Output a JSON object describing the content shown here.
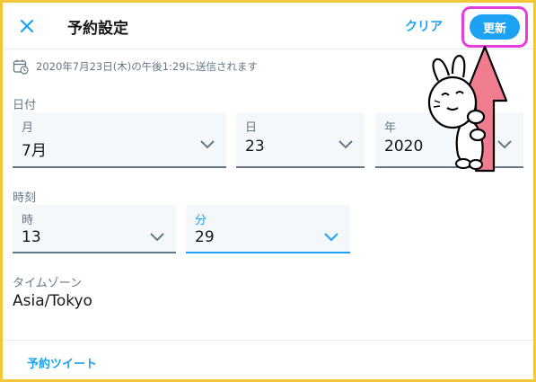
{
  "header": {
    "title": "予約設定",
    "clear_label": "クリア",
    "update_label": "更新"
  },
  "schedule_text": "2020年7月23日(木)の午後1:29に送信されます",
  "date_section": {
    "label": "日付",
    "month": {
      "label": "月",
      "value": "7月"
    },
    "day": {
      "label": "日",
      "value": "23"
    },
    "year": {
      "label": "年",
      "value": "2020"
    }
  },
  "time_section": {
    "label": "時刻",
    "hour": {
      "label": "時",
      "value": "13"
    },
    "minute": {
      "label": "分",
      "value": "29"
    }
  },
  "timezone": {
    "label": "タイムゾーン",
    "value": "Asia/Tokyo"
  },
  "footer": {
    "link_label": "予約ツイート"
  },
  "colors": {
    "accent": "#1da1f2",
    "highlight_border": "#e43fd9",
    "frame": "#f2c73a",
    "arrow": "#ef7d8f"
  }
}
